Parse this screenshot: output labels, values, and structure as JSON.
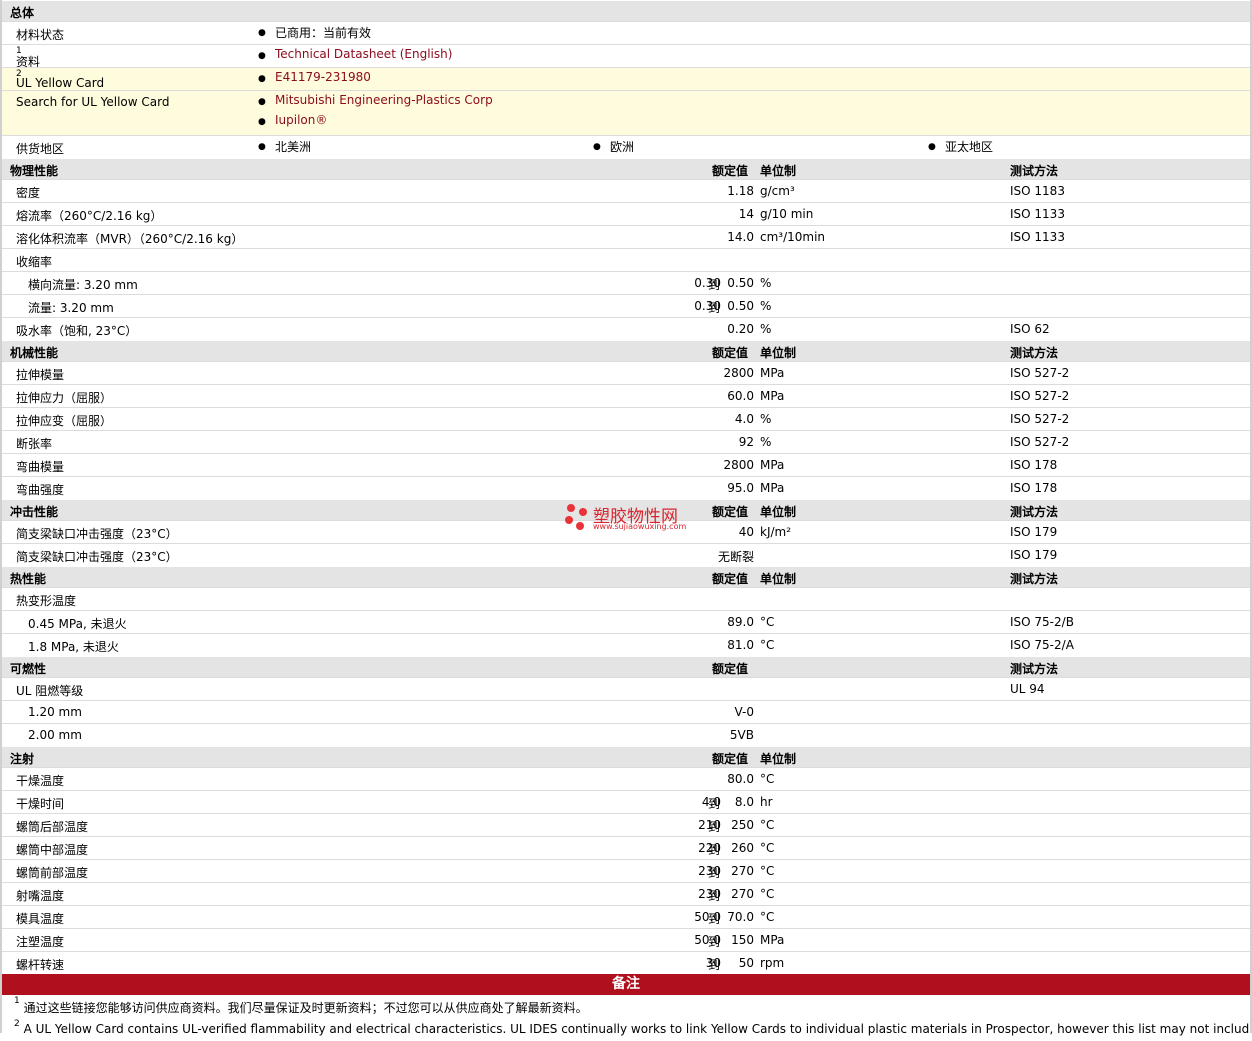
{
  "general": {
    "title": "总体",
    "status_label": "材料状态",
    "status_value": "已商用：当前有效",
    "docs_label": "资料",
    "docs_sup": "1",
    "docs_link": "Technical Datasheet (English)",
    "ul_label": "UL Yellow Card",
    "ul_sup": "2",
    "ul_value": "E41179-231980",
    "search_label": "Search for UL Yellow Card",
    "search_link_1": "Mitsubishi Engineering-Plastics Corp",
    "search_link_2": "Iupilon®",
    "region_label": "供货地区",
    "regions": [
      "北美洲",
      "欧洲",
      "亚太地区"
    ]
  },
  "headers": {
    "nominal": "额定值",
    "unit": "单位制",
    "method": "测试方法"
  },
  "sections": {
    "physical": {
      "title": "物理性能",
      "rows": [
        {
          "label": "密度",
          "value": "1.18",
          "unit": "g/cm³",
          "method": "ISO 1183"
        },
        {
          "label": "熔流率（260°C/2.16 kg）",
          "value": "14",
          "unit": "g/10 min",
          "method": "ISO 1133"
        },
        {
          "label": "溶化体积流率（MVR）（260°C/2.16 kg）",
          "value": "14.0",
          "unit": "cm³/10min",
          "method": "ISO 1133"
        },
        {
          "label": "收缩率"
        },
        {
          "label": "横向流量: 3.20 mm",
          "from": "0.30",
          "to": "到",
          "value": "0.50",
          "unit": "%"
        },
        {
          "label": "流量: 3.20 mm",
          "from": "0.30",
          "to": "到",
          "value": "0.50",
          "unit": "%"
        },
        {
          "label": "吸水率（饱和, 23°C）",
          "value": "0.20",
          "unit": "%",
          "method": "ISO 62"
        }
      ]
    },
    "mechanical": {
      "title": "机械性能",
      "rows": [
        {
          "label": "拉伸模量",
          "value": "2800",
          "unit": "MPa",
          "method": "ISO 527-2"
        },
        {
          "label": "拉伸应力（屈服）",
          "value": "60.0",
          "unit": "MPa",
          "method": "ISO 527-2"
        },
        {
          "label": "拉伸应变（屈服）",
          "value": "4.0",
          "unit": "%",
          "method": "ISO 527-2"
        },
        {
          "label": "断张率",
          "value": "92",
          "unit": "%",
          "method": "ISO 527-2"
        },
        {
          "label": "弯曲模量",
          "value": "2800",
          "unit": "MPa",
          "method": "ISO 178"
        },
        {
          "label": "弯曲强度",
          "value": "95.0",
          "unit": "MPa",
          "method": "ISO 178"
        }
      ]
    },
    "impact": {
      "title": "冲击性能",
      "rows": [
        {
          "label": "简支梁缺口冲击强度（23°C）",
          "value": "40",
          "unit": "kJ/m²",
          "method": "ISO 179"
        },
        {
          "label": "简支梁缺口冲击强度（23°C）",
          "value": "无断裂",
          "method": "ISO 179"
        }
      ]
    },
    "thermal": {
      "title": "热性能",
      "rows": [
        {
          "label": "热变形温度"
        },
        {
          "label": "0.45 MPa, 未退火",
          "value": "89.0",
          "unit": "°C",
          "method": "ISO 75-2/B"
        },
        {
          "label": "1.8 MPa, 未退火",
          "value": "81.0",
          "unit": "°C",
          "method": "ISO 75-2/A"
        }
      ]
    },
    "flammability": {
      "title": "可燃性",
      "rows": [
        {
          "label": "UL 阻燃等级",
          "method": "UL 94"
        },
        {
          "label": "1.20 mm",
          "value": "V-0"
        },
        {
          "label": "2.00 mm",
          "value": "5VB"
        }
      ]
    },
    "injection": {
      "title": "注射",
      "rows": [
        {
          "label": "干燥温度",
          "value": "80.0",
          "unit": "°C"
        },
        {
          "label": "干燥时间",
          "from": "4.0",
          "to": "到",
          "value": "8.0",
          "unit": "hr"
        },
        {
          "label": "螺筒后部温度",
          "from": "210",
          "to": "到",
          "value": "250",
          "unit": "°C"
        },
        {
          "label": "螺筒中部温度",
          "from": "220",
          "to": "到",
          "value": "260",
          "unit": "°C"
        },
        {
          "label": "螺筒前部温度",
          "from": "230",
          "to": "到",
          "value": "270",
          "unit": "°C"
        },
        {
          "label": "射嘴温度",
          "from": "230",
          "to": "到",
          "value": "270",
          "unit": "°C"
        },
        {
          "label": "模具温度",
          "from": "50.0",
          "to": "到",
          "value": "70.0",
          "unit": "°C"
        },
        {
          "label": "注塑温度",
          "from": "50.0",
          "to": "到",
          "value": "150",
          "unit": "MPa"
        },
        {
          "label": "螺杆转速",
          "from": "30",
          "to": "到",
          "value": "50",
          "unit": "rpm"
        }
      ]
    }
  },
  "notes": {
    "title": "备注",
    "note1_num": "1",
    "note1": "通过这些链接您能够访问供应商资料。我们尽量保证及时更新资料；不过您可以从供应商处了解最新资料。",
    "note2_num": "2",
    "note2": "A UL Yellow Card contains UL-verified flammability and electrical characteristics. UL IDES continually works to link Yellow Cards to individual plastic materials in Prospector, however this list may not include all of"
  },
  "watermark": {
    "text": "塑胶物性网",
    "url": "www.sujiaowuxing.com"
  }
}
